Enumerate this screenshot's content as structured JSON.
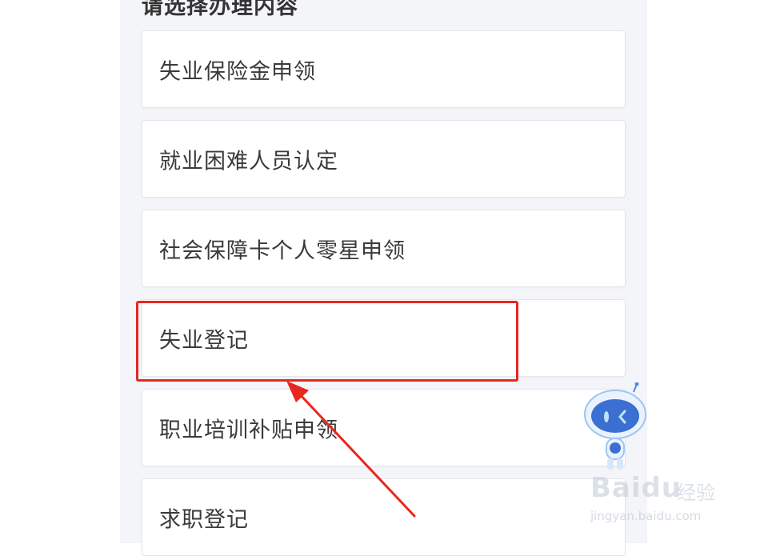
{
  "page": {
    "heading": "请选择办理内容",
    "options": [
      {
        "label": "失业保险金申领"
      },
      {
        "label": "就业困难人员认定"
      },
      {
        "label": "社会保障卡个人零星申领"
      },
      {
        "label": "失业登记"
      },
      {
        "label": "职业培训补贴申领"
      },
      {
        "label": "求职登记"
      }
    ]
  },
  "annotation": {
    "highlight_color": "#e8271f",
    "highlighted_option": "失业登记"
  },
  "watermark": {
    "brand": "Baidu",
    "sub": "经验",
    "url": "jingyan.baidu.com"
  },
  "icons": {
    "mascot": "robot-mascot-icon",
    "arrow": "red-arrow-icon"
  }
}
